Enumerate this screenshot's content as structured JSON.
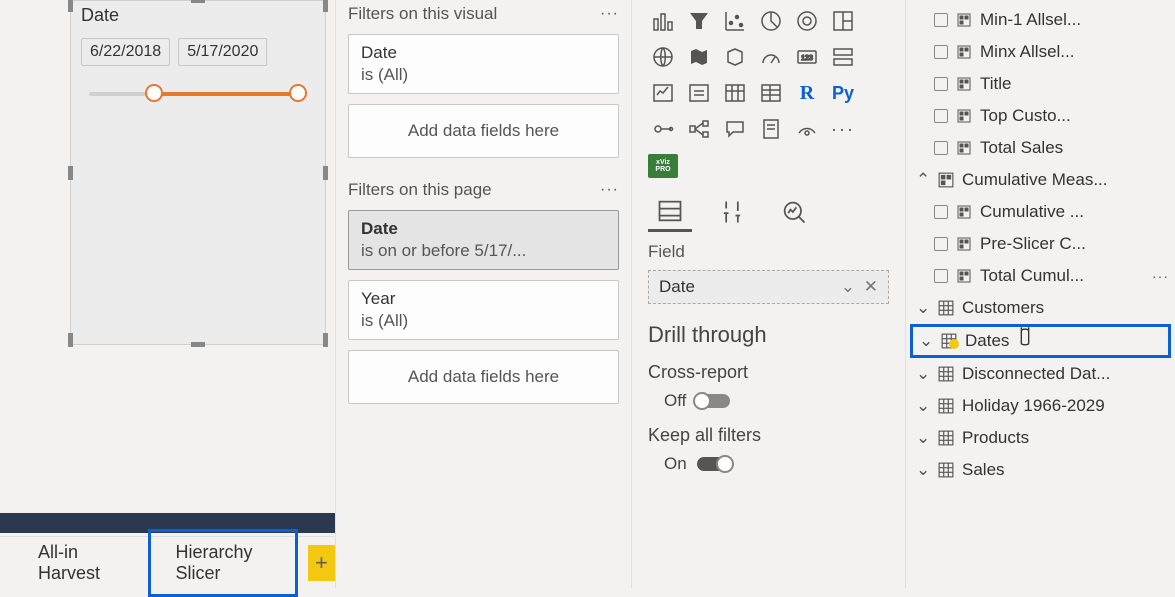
{
  "slicer": {
    "title": "Date",
    "start_date": "6/22/2018",
    "end_date": "5/17/2020"
  },
  "tabs": {
    "tab1": "All-in Harvest",
    "tab2": "Hierarchy Slicer",
    "add": "+"
  },
  "filters": {
    "visual_header": "Filters on this visual",
    "visual_card": {
      "name": "Date",
      "value": "is (All)"
    },
    "drop_label": "Add data fields here",
    "page_header": "Filters on this page",
    "page_card1": {
      "name": "Date",
      "value": "is on or before 5/17/..."
    },
    "page_card2": {
      "name": "Year",
      "value": "is (All)"
    }
  },
  "viz": {
    "pro_label": "xViz PRO",
    "r_label": "R",
    "py_label": "Py",
    "more": "···",
    "field_label": "Field",
    "field_value": "Date",
    "chevron": "⌄",
    "close": "✕",
    "drill_title": "Drill through",
    "cross_report": "Cross-report",
    "cross_state": "Off",
    "keep_filters": "Keep all filters",
    "keep_state": "On"
  },
  "fields": {
    "measures": {
      "m1": "Min-1 Allsel...",
      "m2": "Minx Allsel...",
      "m3": "Title",
      "m4": "Top Custo...",
      "m5": "Total Sales"
    },
    "cumul_header": "Cumulative Meas...",
    "cumul": {
      "c1": "Cumulative ...",
      "c2": "Pre-Slicer C...",
      "c3": "Total Cumul..."
    },
    "tables": {
      "t1": "Customers",
      "t2": "Dates",
      "t3": "Disconnected Dat...",
      "t4": "Holiday 1966-2029",
      "t5": "Products",
      "t6": "Sales"
    },
    "more": "···"
  }
}
